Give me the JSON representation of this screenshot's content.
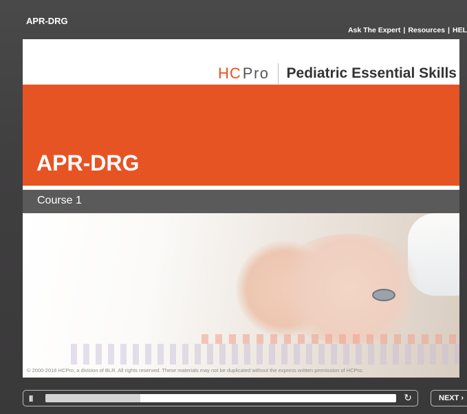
{
  "header": {
    "course_title": "APR-DRG",
    "links": [
      "Ask The Expert",
      "Resources",
      "HEL"
    ]
  },
  "slide": {
    "brand": {
      "logo_h": "H",
      "logo_c": "C",
      "logo_pro": "Pro",
      "product": "Pediatric Essential Skills"
    },
    "banner_title": "APR-DRG",
    "course_label": "Course 1",
    "copyright": "© 2000-2016 HCPro, a division of BLR. All rights reserved. These materials may not be duplicated without the express written permission of HCPro."
  },
  "player": {
    "pause_icon": "pause-icon",
    "pause_label": "II",
    "progress": 0.27,
    "replay_icon": "replay-icon",
    "next_label": "NEXT ›"
  },
  "colors": {
    "accent": "#e75424",
    "course_bar": "#5b5a5b",
    "chrome": "#403f40"
  }
}
